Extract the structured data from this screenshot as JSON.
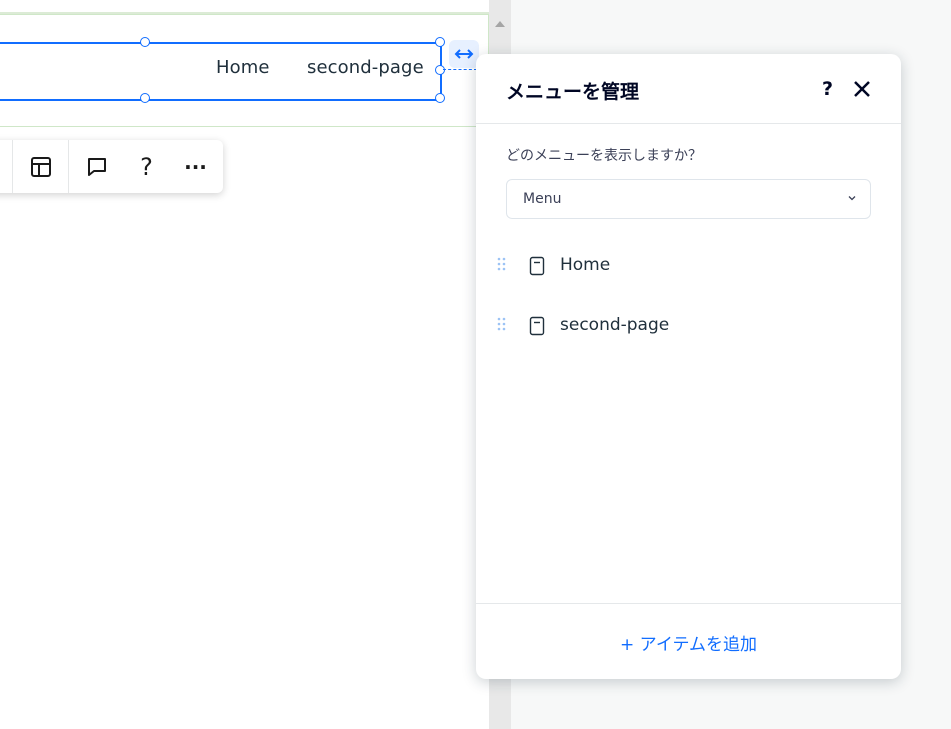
{
  "canvas": {
    "menu_items": [
      "Home",
      "second-page"
    ]
  },
  "toolbar": {
    "buttons": [
      "layout-icon",
      "comment-icon",
      "help-icon",
      "more-icon"
    ],
    "help_label": "?",
    "more_label": "···"
  },
  "panel": {
    "title": "メニューを管理",
    "help_label": "?",
    "question": "どのメニューを表示しますか？",
    "dropdown_value": "Menu",
    "items": [
      {
        "label": "Home"
      },
      {
        "label": "second-page"
      }
    ],
    "add_label": "+ アイテムを追加"
  },
  "colors": {
    "accent": "#116dff",
    "section_border": "#cfe7c8"
  }
}
